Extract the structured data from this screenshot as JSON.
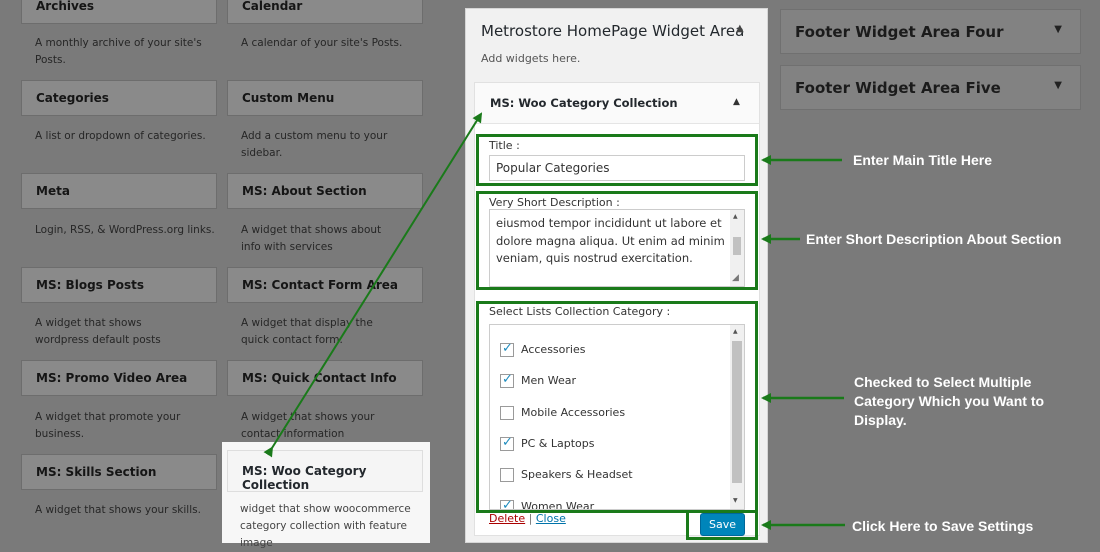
{
  "available_widgets": [
    {
      "title": "Archives",
      "desc": "A monthly archive of your site's Posts."
    },
    {
      "title": "Calendar",
      "desc": "A calendar of your site's Posts."
    },
    {
      "title": "Categories",
      "desc": "A list or dropdown of categories."
    },
    {
      "title": "Custom Menu",
      "desc": "Add a custom menu to your sidebar."
    },
    {
      "title": "Meta",
      "desc": "Login, RSS, & WordPress.org links."
    },
    {
      "title": "MS: About Section",
      "desc": "A widget that shows about info with services"
    },
    {
      "title": "MS: Blogs Posts",
      "desc": "A widget that shows wordpress default posts"
    },
    {
      "title": "MS: Contact Form Area",
      "desc": "A widget that display the quick contact form."
    },
    {
      "title": "MS: Promo Video Area",
      "desc": "A widget that promote your business."
    },
    {
      "title": "MS: Quick Contact Info",
      "desc": "A widget that shows your contact information"
    },
    {
      "title": "MS: Skills Section",
      "desc": "A widget that shows your skills."
    },
    {
      "title": "MS: Woo Category Collection",
      "desc": "widget that show woocommerce category collection with feature image"
    }
  ],
  "sidebars_right": [
    {
      "title": "Footer Widget Area Four"
    },
    {
      "title": "Footer Widget Area Five"
    }
  ],
  "widget_area": {
    "title": "Metrostore HomePage Widget Area",
    "subtitle": "Add widgets here.",
    "widget": {
      "title": "MS: Woo Category Collection",
      "title_label": "Title :",
      "title_value": "Popular Categories",
      "desc_label": "Very Short Description :",
      "desc_value": "eiusmod tempor incididunt ut labore et dolore magna aliqua. Ut enim ad minim veniam, quis nostrud exercitation.",
      "cat_label": "Select Lists Collection Category :",
      "categories": [
        {
          "name": "Accessories",
          "checked": true
        },
        {
          "name": "Men Wear",
          "checked": true
        },
        {
          "name": "Mobile Accessories",
          "checked": false
        },
        {
          "name": "PC & Laptops",
          "checked": true
        },
        {
          "name": "Speakers & Headset",
          "checked": false
        },
        {
          "name": "Women Wear",
          "checked": true
        }
      ],
      "delete_label": "Delete",
      "separator": "|",
      "close_label": "Close",
      "save_label": "Save"
    }
  },
  "annotations": {
    "title": "Enter Main Title Here",
    "desc": "Enter Short Description About Section",
    "cats_line1": "Checked to Select Multiple",
    "cats_line2": "Category Which you Want to",
    "cats_line3": "Display.",
    "save": "Click Here to Save Settings"
  },
  "colors": {
    "annotation_green": "#1a7a1a",
    "save_button": "#0085ba"
  }
}
